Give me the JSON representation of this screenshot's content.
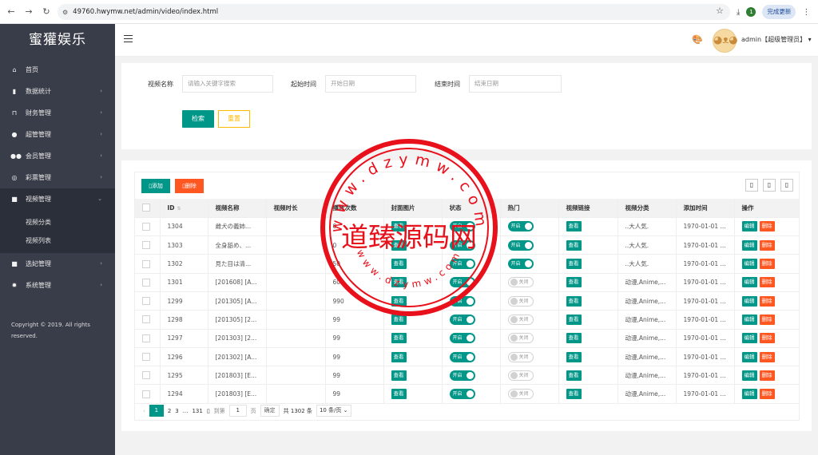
{
  "browser": {
    "url": "49760.hwymw.net/admin/video/index.html",
    "update_label": "完成更新",
    "ext_badge": "1"
  },
  "sidebar": {
    "logo": "蜜獾娱乐",
    "items": [
      {
        "label": "首页",
        "icon": "home-icon"
      },
      {
        "label": "数据统计",
        "icon": "chart-icon"
      },
      {
        "label": "财务管理",
        "icon": "bank-icon"
      },
      {
        "label": "超管管理",
        "icon": "user-icon"
      },
      {
        "label": "会员管理",
        "icon": "users-icon"
      },
      {
        "label": "彩票管理",
        "icon": "gamepad-icon"
      },
      {
        "label": "视频管理",
        "icon": "video-icon"
      },
      {
        "label": "选妃管理",
        "icon": "video-icon"
      },
      {
        "label": "系统管理",
        "icon": "gear-icon"
      }
    ],
    "sub_items": [
      "视频分类",
      "视频列表"
    ],
    "copyright_1": "Copyright © 2019. All rights",
    "copyright_2": "reserved."
  },
  "header": {
    "user": "admin【超级管理员】"
  },
  "search": {
    "name_label": "视频名称",
    "name_placeholder": "请输入关键字搜索",
    "start_label": "起始时间",
    "start_placeholder": "开始日期",
    "end_label": "结束时间",
    "end_placeholder": "结束日期",
    "search_btn": "检索",
    "reset_btn": "重置"
  },
  "table": {
    "add_btn": "添加",
    "del_btn": "删除",
    "columns": [
      "ID",
      "视频名称",
      "视频时长",
      "播放次数",
      "封面图片",
      "状态",
      "热门",
      "视频链接",
      "视频分类",
      "添加时间",
      "操作"
    ],
    "view_label": "查看",
    "edit_label": "编辑",
    "delete_label": "删除",
    "on_label": "开启",
    "off_label": "关闭",
    "rows": [
      {
        "id": "1304",
        "name": "雌犬の義姉...",
        "duration": "",
        "plays": "0",
        "status": "on",
        "hot": "on",
        "category": "..大人気.",
        "time": "1970-01-01 ..."
      },
      {
        "id": "1303",
        "name": "全身舐め、...",
        "duration": "",
        "plays": "0",
        "status": "on",
        "hot": "on",
        "category": "..大人気.",
        "time": "1970-01-01 ..."
      },
      {
        "id": "1302",
        "name": "見た目は清...",
        "duration": "",
        "plays": "50",
        "status": "on",
        "hot": "on",
        "category": "..大人気.",
        "time": "1970-01-01 ..."
      },
      {
        "id": "1301",
        "name": "[201608] [A...",
        "duration": "",
        "plays": "600",
        "status": "on",
        "hot": "off",
        "category": "动漫,Anime,...",
        "time": "1970-01-01 ..."
      },
      {
        "id": "1299",
        "name": "[201305] [A...",
        "duration": "",
        "plays": "990",
        "status": "on",
        "hot": "off",
        "category": "动漫,Anime,...",
        "time": "1970-01-01 ..."
      },
      {
        "id": "1298",
        "name": "[201305] [2...",
        "duration": "",
        "plays": "99",
        "status": "on",
        "hot": "off",
        "category": "动漫,Anime,...",
        "time": "1970-01-01 ..."
      },
      {
        "id": "1297",
        "name": "[201303] [2...",
        "duration": "",
        "plays": "99",
        "status": "on",
        "hot": "off",
        "category": "动漫,Anime,...",
        "time": "1970-01-01 ..."
      },
      {
        "id": "1296",
        "name": "[201302] [A...",
        "duration": "",
        "plays": "99",
        "status": "on",
        "hot": "off",
        "category": "动漫,Anime,...",
        "time": "1970-01-01 ..."
      },
      {
        "id": "1295",
        "name": "[201803] [E...",
        "duration": "",
        "plays": "99",
        "status": "on",
        "hot": "off",
        "category": "动漫,Anime,...",
        "time": "1970-01-01 ..."
      },
      {
        "id": "1294",
        "name": "[201803] [E...",
        "duration": "",
        "plays": "99",
        "status": "on",
        "hot": "off",
        "category": "动漫,Anime,...",
        "time": "1970-01-01 ..."
      }
    ]
  },
  "pager": {
    "pages": [
      "1",
      "2",
      "3",
      "...",
      "131"
    ],
    "goto_label": "到第",
    "goto_value": "1",
    "page_unit": "页",
    "confirm": "确定",
    "total": "共 1302 条",
    "page_size": "10 条/页"
  },
  "watermark": {
    "text": "道臻源码网",
    "ring": "www.dzymw.com",
    "color": "#e8101a"
  }
}
